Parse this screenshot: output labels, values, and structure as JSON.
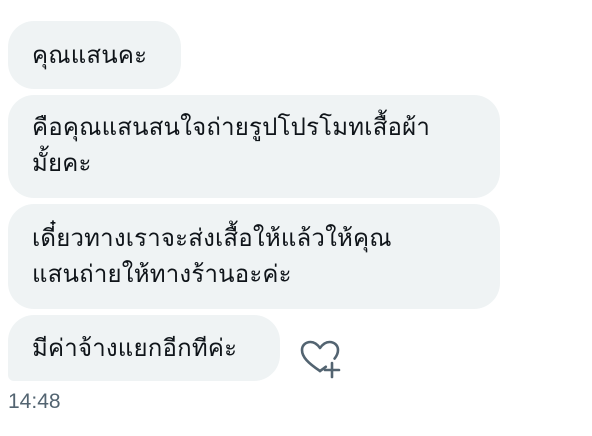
{
  "messages": [
    {
      "text": "คุณแสนคะ"
    },
    {
      "text": "คือคุณแสนสนใจถ่ายรูปโปรโมทเสื้อผ้า\nมั้ยคะ"
    },
    {
      "text": "เดี๋ยวทางเราจะส่งเสื้อให้แล้วให้คุณ\nแสนถ่ายให้ทางร้านอะค่ะ"
    },
    {
      "text": "มีค่าจ้างแยกอีกทีค่ะ"
    }
  ],
  "timestamp": "14:48",
  "react_icon": "heart-plus-icon",
  "colors": {
    "bubble_bg": "#eff3f4",
    "text": "#0f1419",
    "muted": "#536471"
  }
}
